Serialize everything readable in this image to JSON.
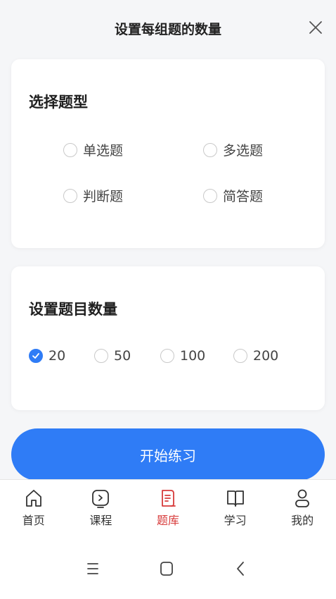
{
  "dialog": {
    "title": "设置每组题的数量"
  },
  "question_type": {
    "title": "选择题型",
    "options": [
      {
        "label": "单选题",
        "checked": false
      },
      {
        "label": "多选题",
        "checked": false
      },
      {
        "label": "判断题",
        "checked": false
      },
      {
        "label": "简答题",
        "checked": false
      }
    ]
  },
  "question_count": {
    "title": "设置题目数量",
    "options": [
      {
        "label": "20",
        "checked": true
      },
      {
        "label": "50",
        "checked": false
      },
      {
        "label": "100",
        "checked": false
      },
      {
        "label": "200",
        "checked": false
      }
    ]
  },
  "start_button": {
    "label": "开始练习"
  },
  "tabbar": {
    "items": [
      {
        "label": "首页",
        "icon": "home-icon",
        "active": false
      },
      {
        "label": "课程",
        "icon": "play-icon",
        "active": false
      },
      {
        "label": "题库",
        "icon": "document-icon",
        "active": true
      },
      {
        "label": "学习",
        "icon": "book-icon",
        "active": false
      },
      {
        "label": "我的",
        "icon": "user-icon",
        "active": false
      }
    ]
  },
  "colors": {
    "accent": "#2f7cf6",
    "active_tab": "#d73a3a"
  }
}
